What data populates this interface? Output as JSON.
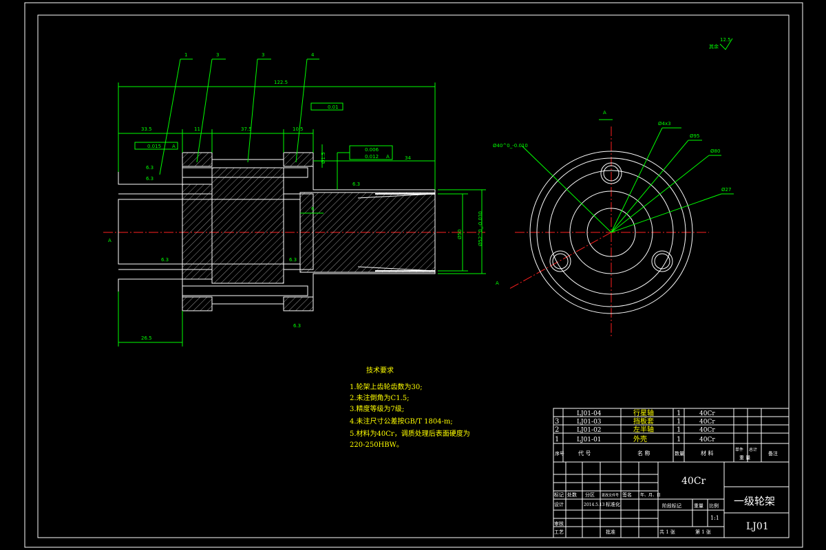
{
  "header": {
    "roughness_note": "其余",
    "roughness_value": "12.5"
  },
  "balloons": [
    "1",
    "3",
    "3",
    "4"
  ],
  "dimensions": {
    "overall": "122.5",
    "d1": "33.5",
    "d2": "11",
    "d3": "37.5",
    "d4": "10.5",
    "d5": "34",
    "d6": "26.5",
    "d7": "6",
    "d8": "Ø1.5",
    "left_dia": "Ø50",
    "right_dia": "Ø52^0_-0.030",
    "tol_flat_left": "0.015",
    "tol_flat_right": "0.006",
    "tol_runout": "0.012",
    "tol_top": "0.01",
    "datum": "A",
    "rough": "6.3"
  },
  "end_view": {
    "hole": "Ø4x3",
    "bore": "Ø40^0_-0.010",
    "d95": "Ø95",
    "d80": "Ø80",
    "d27": "Ø27",
    "section_mark": "A"
  },
  "tech_req": {
    "title": "技术要求",
    "items": [
      "1.轮架上齿轮齿数为30;",
      "2.未注倒角为C1.5;",
      "3.精度等级为7级;",
      "4.未注尺寸公差按GB/T 1804-m;",
      "5.材料为40Cr，调质处理后表面硬度为",
      "220-250HBW。"
    ]
  },
  "parts": {
    "rows": [
      {
        "no": "",
        "code": "LJ01-04",
        "name": "行星轴",
        "qty": "1",
        "material": "40Cr"
      },
      {
        "no": "3",
        "code": "LJ01-03",
        "name": "挡板套",
        "qty": "1",
        "material": "40Cr"
      },
      {
        "no": "2",
        "code": "LJ01-02",
        "name": "左半轴",
        "qty": "1",
        "material": "40Cr"
      },
      {
        "no": "1",
        "code": "LJ01-01",
        "name": "外壳",
        "qty": "1",
        "material": "40Cr"
      }
    ],
    "header": {
      "no": "序号",
      "code": "代 号",
      "name": "名 称",
      "qty": "数量",
      "material": "材 料",
      "unit": "单件",
      "total": "总计",
      "weight": "重 量",
      "remark": "备注"
    }
  },
  "title_block": {
    "material": "40Cr",
    "title": "一级轮架",
    "drawing_no": "LJ01",
    "scale": "1:1",
    "sheets": "共 1 张",
    "sheet_no": "第 1 张",
    "labels": [
      "标记",
      "处数",
      "分区",
      "更改文件号",
      "签名",
      "年、月、日",
      "设计",
      "2014.5.13",
      "标准化",
      "阶段标记",
      "重量",
      "比例",
      "审核",
      "工艺",
      "批准"
    ]
  }
}
